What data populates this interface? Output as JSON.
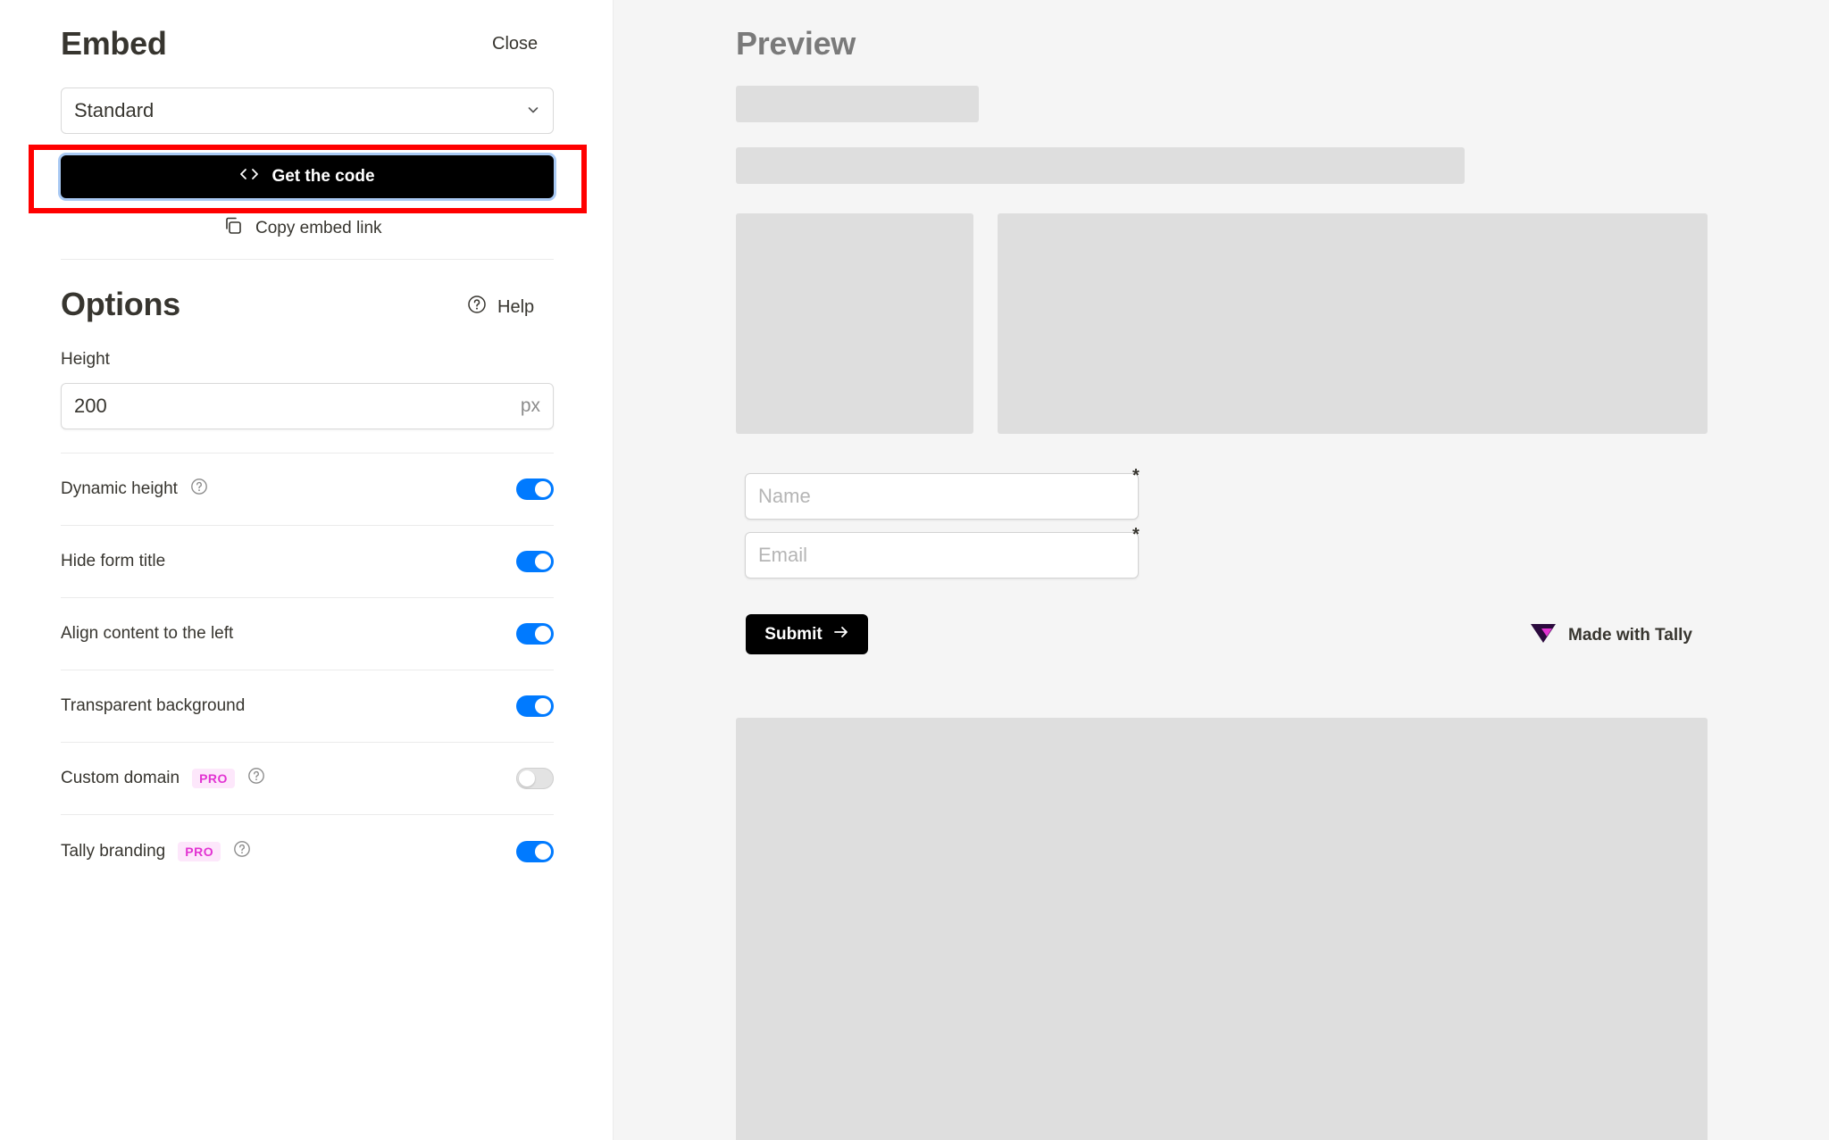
{
  "embed": {
    "title": "Embed",
    "close_label": "Close",
    "mode_select": {
      "value": "Standard"
    },
    "get_code_label": "Get the code",
    "copy_link_label": "Copy embed link"
  },
  "options": {
    "title": "Options",
    "help_label": "Help",
    "height_label": "Height",
    "height_value": "200",
    "height_unit": "px",
    "rows": [
      {
        "label": "Dynamic height",
        "help": true,
        "pro": false,
        "enabled": true
      },
      {
        "label": "Hide form title",
        "help": false,
        "pro": false,
        "enabled": true
      },
      {
        "label": "Align content to the left",
        "help": false,
        "pro": false,
        "enabled": true
      },
      {
        "label": "Transparent background",
        "help": false,
        "pro": false,
        "enabled": true
      },
      {
        "label": "Custom domain",
        "help": true,
        "pro": true,
        "enabled": false
      },
      {
        "label": "Tally branding",
        "help": true,
        "pro": true,
        "enabled": true
      }
    ],
    "pro_badge": "PRO"
  },
  "preview": {
    "title": "Preview",
    "name_placeholder": "Name",
    "email_placeholder": "Email",
    "required_mark": "*",
    "submit_label": "Submit",
    "branding_label": "Made with Tally"
  },
  "colors": {
    "toggle_on": "#007aff",
    "highlight": "#ff0000",
    "pro_text": "#e233d2",
    "pro_bg": "#fde7fb"
  }
}
